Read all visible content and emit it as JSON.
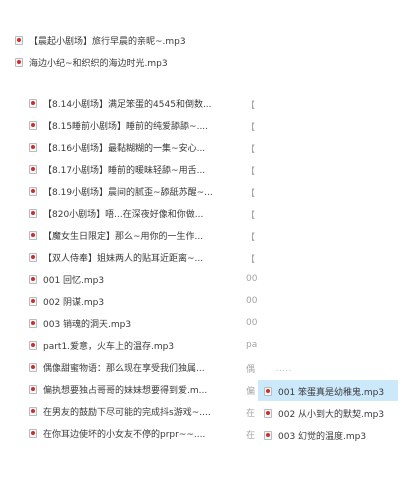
{
  "top_files": [
    "【晨起小剧场】旅行早晨的亲昵~.mp3",
    "海边小纪~和织织的海边时光.mp3"
  ],
  "files": [
    {
      "name": "【8.14小剧场】满足笨蛋的4545和倒数...",
      "col2": "【"
    },
    {
      "name": "【8.15睡前小剧场】睡前的纯爱舔舔~....",
      "col2": "【"
    },
    {
      "name": "【8.16小剧场】最黏糊糊的一集~安心...",
      "col2": "【"
    },
    {
      "name": "【8.17小剧场】睡前的暖昧轻舔~用舌...",
      "col2": "【"
    },
    {
      "name": "【8.19小剧场】晨间的腻歪~舔舐苏醒~...",
      "col2": "【"
    },
    {
      "name": "【820小剧场】唔...在深夜好像和你做...",
      "col2": "【"
    },
    {
      "name": "【魔女生日限定】那么~用你的一生作...",
      "col2": "【"
    },
    {
      "name": "【双人侍奉】姐妹两人的贴耳近距离~...",
      "col2": "【"
    },
    {
      "name": "001 回忆.mp3",
      "col2": "00"
    },
    {
      "name": "002 阴谋.mp3",
      "col2": "00"
    },
    {
      "name": "003 销魂的洞天.mp3",
      "col2": "00"
    },
    {
      "name": "part1.爱意，火车上的温存.mp3",
      "col2": "pa"
    },
    {
      "name": "偶像甜蜜物语：那么现在享受我们独属...",
      "col2": "偶"
    },
    {
      "name": "偏执想要独占哥哥的妹妹想要得到爱.m...",
      "col2": "偏"
    },
    {
      "name": "在男友的鼓励下尽可能的完成抖s游戏~....",
      "col2": "在"
    },
    {
      "name": "在你耳边使坏的小女友不停的prpr~~....",
      "col2": "在"
    }
  ],
  "submenu": [
    "001 笨蛋真是幼稚鬼.mp3",
    "002 从小到大的默契.mp3",
    "003 幻觉的温度.mp3"
  ]
}
